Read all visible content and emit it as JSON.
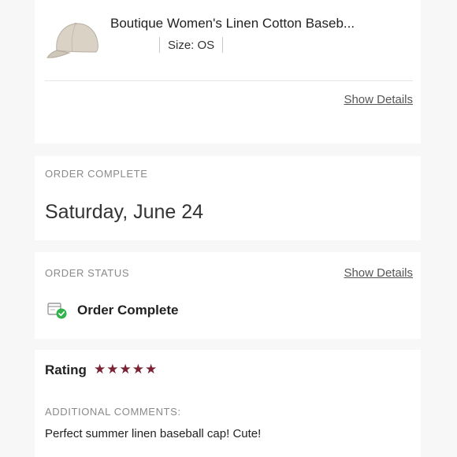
{
  "product": {
    "title": "Boutique Women's Linen Cotton Baseb...",
    "size_text": "Size: OS",
    "show_details": "Show Details",
    "image_icon": "baseball-cap-image"
  },
  "order_complete": {
    "label": "ORDER COMPLETE",
    "date": "Saturday, June 24"
  },
  "order_status": {
    "label": "ORDER STATUS",
    "show_details": "Show Details",
    "status_text": "Order Complete",
    "icon": "package-check-icon"
  },
  "rating": {
    "label": "Rating",
    "stars": 5,
    "max_stars": 5,
    "star_color": "#7a2233",
    "comments_label": "ADDITIONAL COMMENTS:",
    "comment": "Perfect summer linen baseball cap! Cute!"
  },
  "colors": {
    "check_green": "#2fb34a",
    "link_gray": "#555555"
  }
}
